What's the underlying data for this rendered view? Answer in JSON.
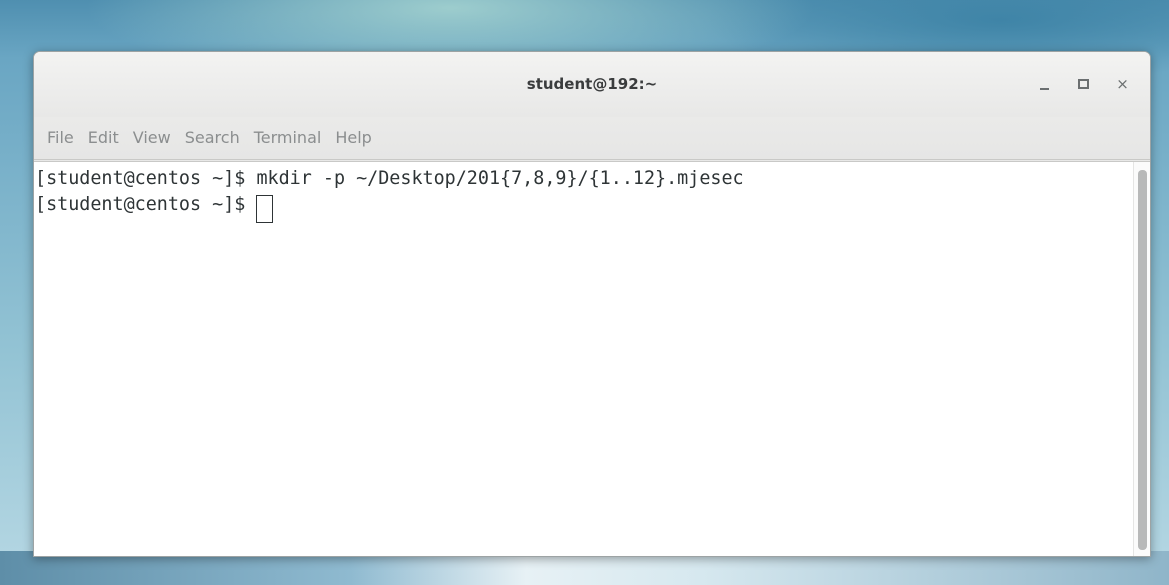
{
  "window": {
    "title": "student@192:~",
    "controls": {
      "minimize_icon": "minimize-icon",
      "maximize_icon": "maximize-icon",
      "close_icon": "close-icon",
      "close_glyph": "×"
    }
  },
  "menu": {
    "items": [
      {
        "label": "File"
      },
      {
        "label": "Edit"
      },
      {
        "label": "View"
      },
      {
        "label": "Search"
      },
      {
        "label": "Terminal"
      },
      {
        "label": "Help"
      }
    ]
  },
  "terminal": {
    "lines": [
      {
        "text": "[student@centos ~]$ mkdir -p ~/Desktop/201{7,8,9}/{1..12}.mjesec"
      },
      {
        "text": "[student@centos ~]$ "
      }
    ],
    "text_color": "#2e3436",
    "background": "#ffffff"
  }
}
